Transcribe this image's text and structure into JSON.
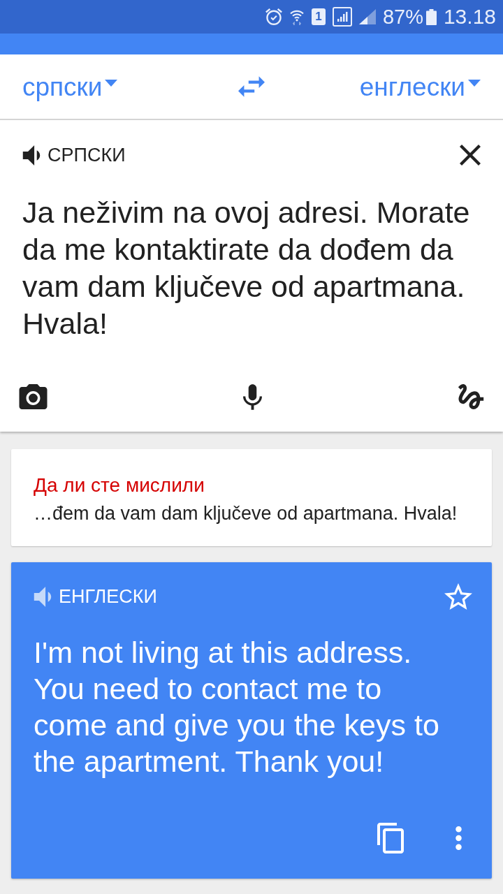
{
  "status_bar": {
    "sim_slot": "1",
    "battery_percent": "87%",
    "time": "13.18"
  },
  "language_bar": {
    "source_language": "српски",
    "target_language": "енглески"
  },
  "input": {
    "language": "СРПСКИ",
    "text": "Ja neživim na ovoj adresi. Morate da me kontaktirate da dođem da vam dam ključeve od apartmana. Hvala!"
  },
  "suggestion": {
    "heading": "Да ли сте мислили",
    "text": "…đem da vam dam ključeve od apartmana. Hvala!"
  },
  "translation": {
    "language": "ЕНГЛЕСКИ",
    "starred": false,
    "text": "I'm not living at this address. You need to contact me to come and give you the keys to the apartment. Thank you!"
  }
}
